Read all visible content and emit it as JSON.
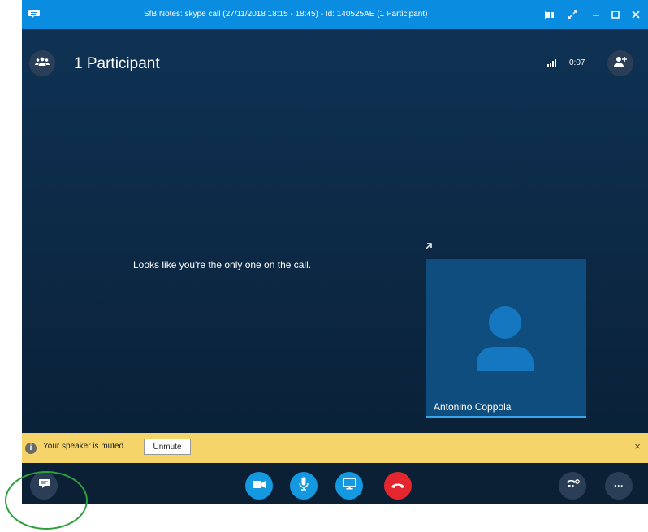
{
  "titlebar": {
    "title": "SfB Notes: skype call  (27/11/2018 18:15 -  18:45) - Id: 140525AE (1 Participant)",
    "accent": "#0a8de0"
  },
  "header": {
    "participants_label": "1 Participant",
    "timer": "0:07"
  },
  "stage": {
    "message": "Looks like you're the only one on the call."
  },
  "video_tile": {
    "name": "Antonino Coppola",
    "background": "#0e4d7d"
  },
  "notice": {
    "text": "Your speaker is muted.",
    "unmute_label": "Unmute",
    "close_label": "×",
    "info_label": "i",
    "background": "#f5d56a"
  },
  "controls": {
    "more_label": "···",
    "colors": {
      "blue": "#1498e0",
      "red": "#e4272f"
    }
  },
  "icons": [
    "app-icon",
    "participants-icon",
    "signal-icon",
    "add-person-icon",
    "popout-icon",
    "chat-icon",
    "video-camera-icon",
    "microphone-icon",
    "present-screen-icon",
    "hang-up-icon",
    "call-controls-icon",
    "more-icon"
  ]
}
